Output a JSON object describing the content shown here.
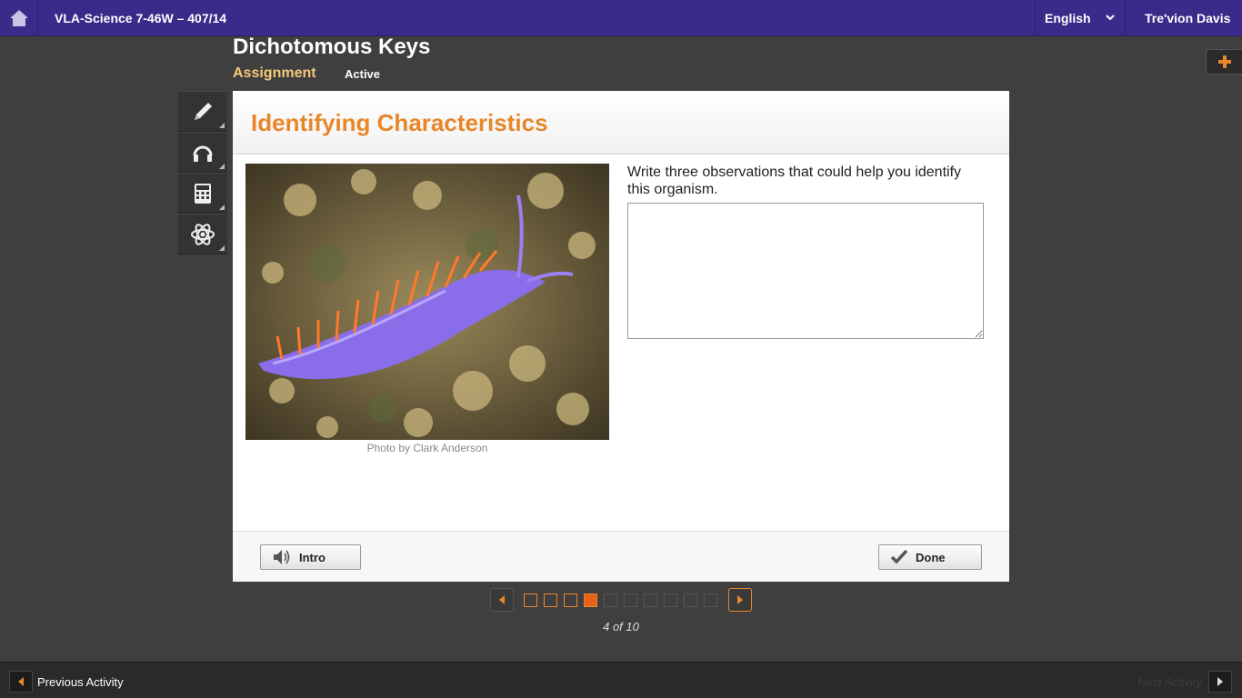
{
  "topbar": {
    "course_title": "VLA-Science 7-46W – 407/14",
    "language": "English",
    "user_name": "Tre'vion Davis"
  },
  "lesson": {
    "title": "Dichotomous Keys",
    "type_label": "Assignment",
    "status": "Active"
  },
  "tools": [
    "pencil-icon",
    "headphones-icon",
    "calculator-icon",
    "atom-icon"
  ],
  "activity": {
    "title": "Identifying Characteristics",
    "photo_credit": "Photo by Clark Anderson",
    "prompt": "Write three observations that could help you identify this organism.",
    "answer_value": ""
  },
  "footer_buttons": {
    "intro": "Intro",
    "done": "Done"
  },
  "pager": {
    "current": 4,
    "total": 10,
    "label": "4 of 10"
  },
  "bottom_nav": {
    "previous": "Previous Activity",
    "next": "Next Activity"
  },
  "colors": {
    "topbar": "#3a2a8a",
    "accent_orange": "#e8872a",
    "assignment_yellow": "#f5c97a",
    "background": "#3f3f3f"
  }
}
